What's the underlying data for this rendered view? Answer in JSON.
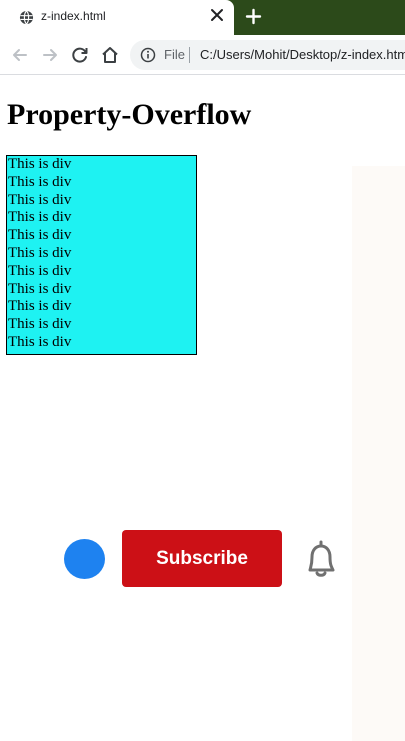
{
  "browser": {
    "tab_title": "z-index.html",
    "address_scheme": "File",
    "address_url": "C:/Users/Mohit/Desktop/z-index.html"
  },
  "page": {
    "heading": "Property-Overflow",
    "div_lines": [
      "This is div",
      "This is div",
      "This is div",
      "This is div",
      "This is div",
      "This is div",
      "This is div",
      "This is div",
      "This is div",
      "This is div",
      "This is div"
    ]
  },
  "overlay": {
    "subscribe_label": "Subscribe"
  },
  "colors": {
    "tabbar": "#2c4a1a",
    "div_bg": "#1ef2f2",
    "subscribe": "#cc1016",
    "dot": "#1e82f0"
  },
  "icons": [
    "globe-icon",
    "close-icon",
    "plus-icon",
    "back-icon",
    "forward-icon",
    "reload-icon",
    "home-icon",
    "info-icon",
    "bell-icon"
  ]
}
